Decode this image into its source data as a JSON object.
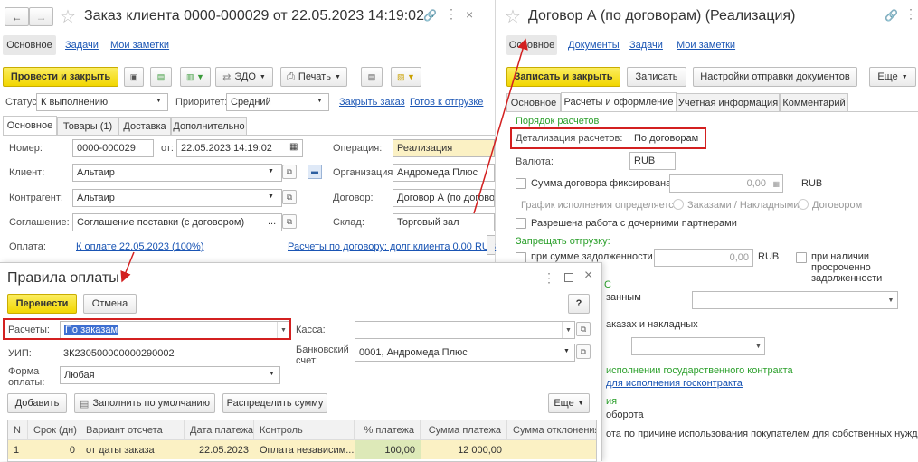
{
  "left": {
    "title": "Заказ клиента 0000-000029 от 22.05.2023 14:19:02",
    "nav": [
      "Основное",
      "Задачи",
      "Мои заметки"
    ],
    "toolbar": {
      "post_close": "Провести и закрыть",
      "edo": "ЭДО",
      "print": "Печать"
    },
    "status": {
      "label": "Статус:",
      "value": "К выполнению",
      "priority_label": "Приоритет:",
      "priority_value": "Средний",
      "close_link": "Закрыть заказ",
      "ready_link": "Готов к отгрузке"
    },
    "tabs": [
      "Основное",
      "Товары (1)",
      "Доставка",
      "Дополнительно"
    ],
    "fields": {
      "number_label": "Номер:",
      "number": "0000-000029",
      "from_label": "от:",
      "date": "22.05.2023 14:19:02",
      "operation_label": "Операция:",
      "operation": "Реализация",
      "client_label": "Клиент:",
      "client": "Альтаир",
      "org_label": "Организация:",
      "org": "Андромеда Плюс",
      "contractor_label": "Контрагент:",
      "contractor": "Альтаир",
      "contract_label": "Договор:",
      "contract": "Договор А (по догово",
      "agreement_label": "Соглашение:",
      "agreement": "Соглашение поставки (с договором)",
      "warehouse_label": "Склад:",
      "warehouse": "Торговый зал",
      "payment_label": "Оплата:",
      "payment_link": "К оплате 22.05.2023 (100%)",
      "debt_link": "Расчеты по договору: долг клиента 0,00 RUB"
    }
  },
  "right": {
    "title": "Договор А (по договорам) (Реализация)",
    "nav": [
      "Основное",
      "Документы",
      "Задачи",
      "Мои заметки"
    ],
    "toolbar": {
      "save_close": "Записать и закрыть",
      "save": "Записать",
      "settings": "Настройки отправки документов",
      "more": "Еще"
    },
    "tabs": [
      "Основное",
      "Расчеты и оформление",
      "Учетная информация",
      "Комментарий"
    ],
    "section_order": "Порядок расчетов",
    "detail_label": "Детализация расчетов:",
    "detail_value": "По договорам",
    "currency_label": "Валюта:",
    "currency": "RUB",
    "fixed_amount_label": "Сумма договора фиксирована",
    "fixed_amount": "0,00",
    "fixed_currency": "RUB",
    "schedule_label": "График исполнения определяется:",
    "radio1": "Заказами / Накладными",
    "radio2": "Договором",
    "subpartners": "Разрешена работа с дочерними партнерами",
    "section_ship": "Запрещать отгрузку:",
    "debt_amount_label": "при сумме задолженности",
    "debt_amount": "0,00",
    "debt_currency": "RUB",
    "overdue_label_1": "при наличии просроченно",
    "overdue_label_2": "задолженности",
    "frag_c": "С",
    "frag_ordered": "занным",
    "frag_orders": "аказах и накладных",
    "frag_gov": "исполнении государственного контракта",
    "frag_gov_link": "для исполнения госконтракта",
    "frag_ia": "ия",
    "frag_turn": "оборота",
    "frag_reason": "ота по причине использования покупателем для собственных нужд"
  },
  "dialog": {
    "title": "Правила оплаты",
    "transfer": "Перенести",
    "cancel": "Отмена",
    "help": "?",
    "settlements_label": "Расчеты:",
    "settlements_value": "По заказам",
    "kassa_label": "Касса:",
    "uip_label": "УИП:",
    "uip": "3К230500000000290002",
    "bank_label_1": "Банковский",
    "bank_label_2": "счет:",
    "bank": "0001, Андромеда Плюс",
    "form_label_1": "Форма",
    "form_label_2": "оплаты:",
    "form_value": "Любая",
    "add": "Добавить",
    "fill_default": "Заполнить по умолчанию",
    "distribute": "Распределить сумму",
    "more": "Еще",
    "columns": [
      "N",
      "Срок (дн)",
      "Вариант отсчета",
      "Дата платежа",
      "Контроль",
      "% платежа",
      "Сумма платежа",
      "Сумма отклонения"
    ],
    "rows": [
      [
        "1",
        "0",
        "от даты заказа",
        "22.05.2023",
        "Оплата независим...",
        "100,00",
        "12 000,00",
        ""
      ]
    ]
  },
  "colors": {
    "accent_yellow": "#f5db00",
    "link_blue": "#1a55b4",
    "green_header": "#2ca02c",
    "highlight_red": "#d32020",
    "selected_row": "#fbf1c4"
  }
}
